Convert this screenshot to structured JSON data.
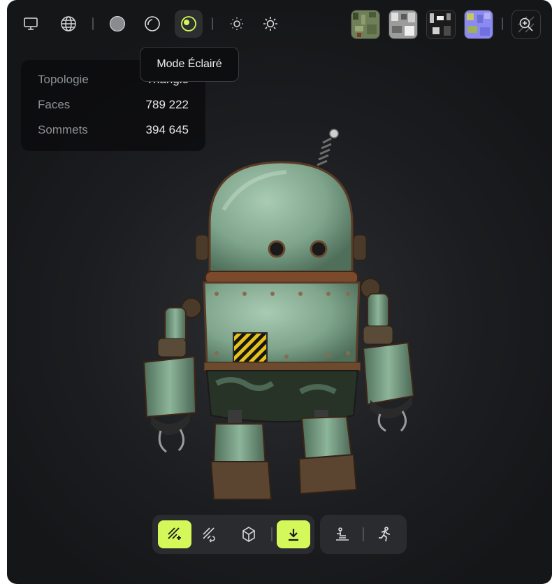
{
  "toolbar": {
    "tools": [
      {
        "name": "monitor-icon"
      },
      {
        "name": "wireframe-sphere-icon"
      },
      {
        "name": "solid-sphere-icon"
      },
      {
        "name": "outline-sphere-icon"
      },
      {
        "name": "lit-sphere-icon",
        "active": true
      },
      {
        "name": "light-dim-icon"
      },
      {
        "name": "light-bright-icon"
      }
    ],
    "tooltip": "Mode Éclairé",
    "textures": [
      "texture-1",
      "texture-2",
      "texture-3",
      "texture-4"
    ],
    "zoom": "zoom-icon"
  },
  "stats": {
    "topology_label": "Topologie",
    "topology_value": "Triangle",
    "faces_label": "Faces",
    "faces_value": "789 222",
    "vertices_label": "Sommets",
    "vertices_value": "394 645"
  },
  "bottom_bar": {
    "left_group": [
      "generate-icon",
      "retexture-icon",
      "cube-icon",
      "download-icon"
    ],
    "right_group": [
      "pose-icon",
      "animate-icon"
    ]
  },
  "colors": {
    "accent": "#d4f75a",
    "background": "#1c1d20",
    "robot_body": "#7fa58c",
    "rust": "#7b4a2c"
  }
}
